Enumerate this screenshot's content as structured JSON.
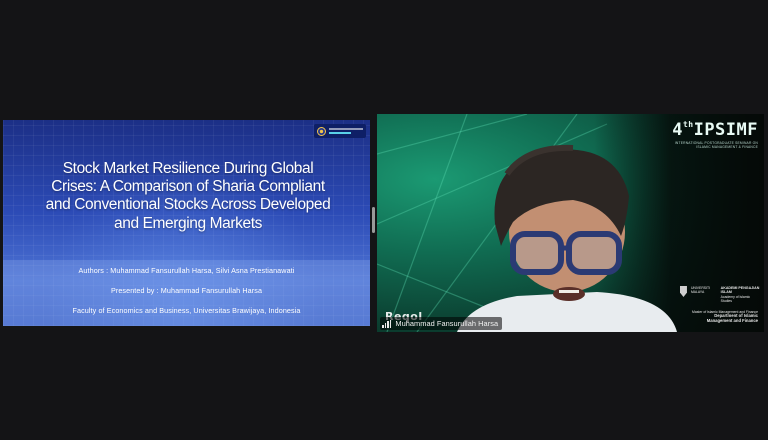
{
  "slide": {
    "title": "Stock Market Resilience During Global Crises: A Comparison of Sharia Compliant and Conventional Stocks Across Developed and Emerging Markets",
    "authors": "Authors : Muhammad Fansurullah Harsa, Silvi Asna Prestianawati",
    "presenter": "Presented by : Muhammad Fansurullah Harsa",
    "affiliation": "Faculty of Economics and Business, Universitas Brawijaya, Indonesia"
  },
  "video": {
    "participant_name": "Muhammad Fansurullah Harsa",
    "watermark": "Reqol",
    "event_logo": {
      "number": "4",
      "suffix": "th",
      "name": "IPSIMF",
      "tagline": "International Postgraduate Seminar on Islamic Management & Finance"
    },
    "institution": {
      "left": "UNIVERSITI MALAYA",
      "right_title": "AKADEMI PENGAJIAN ISLAM",
      "right_sub": "Academy of Islamic Studies"
    },
    "footer_line1": "Master of Islamic Management and Finance",
    "footer_line2": "Department of Islamic Management and Finance"
  },
  "icons": {
    "signal": "signal-strength-icon",
    "slide_badge": "university-logo-icon",
    "crest": "university-crest-icon"
  },
  "colors": {
    "slide_bg": "#2c4bb6",
    "video_bg": "#106b51",
    "app_bg": "#141416"
  }
}
